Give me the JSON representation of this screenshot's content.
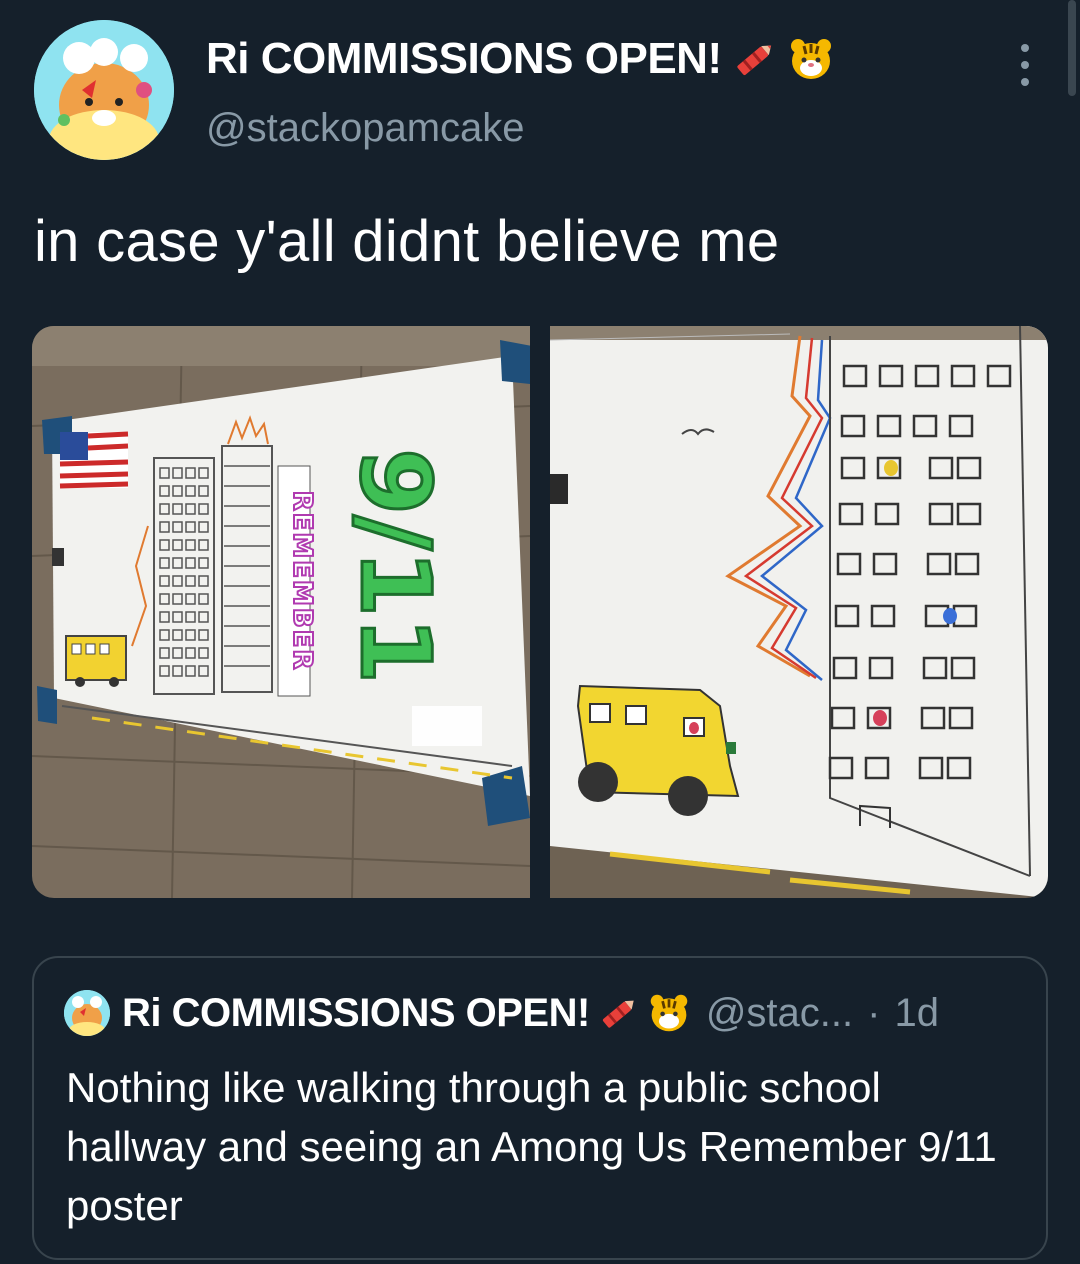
{
  "author": {
    "display_name": "Ri COMMISSIONS OPEN!",
    "handle": "@stackopamcake",
    "emojis": [
      "crayon-icon",
      "tiger-face-icon"
    ]
  },
  "tweet": {
    "text": "in case y'all didnt believe me"
  },
  "media": {
    "photos": [
      {
        "name": "poster-full-view",
        "text": {
          "remember": "REMEMBER",
          "date": "9/11"
        }
      },
      {
        "name": "poster-closeup"
      }
    ]
  },
  "quoted_tweet": {
    "display_name": "Ri COMMISSIONS OPEN!",
    "handle": "@stac...",
    "separator": "·",
    "time": "1d",
    "text": "Nothing like walking through a public school hallway and seeing an Among Us Remember 9/11 poster"
  },
  "colors": {
    "background": "#15202b",
    "secondary_text": "#8899a6",
    "border": "#38444d"
  }
}
